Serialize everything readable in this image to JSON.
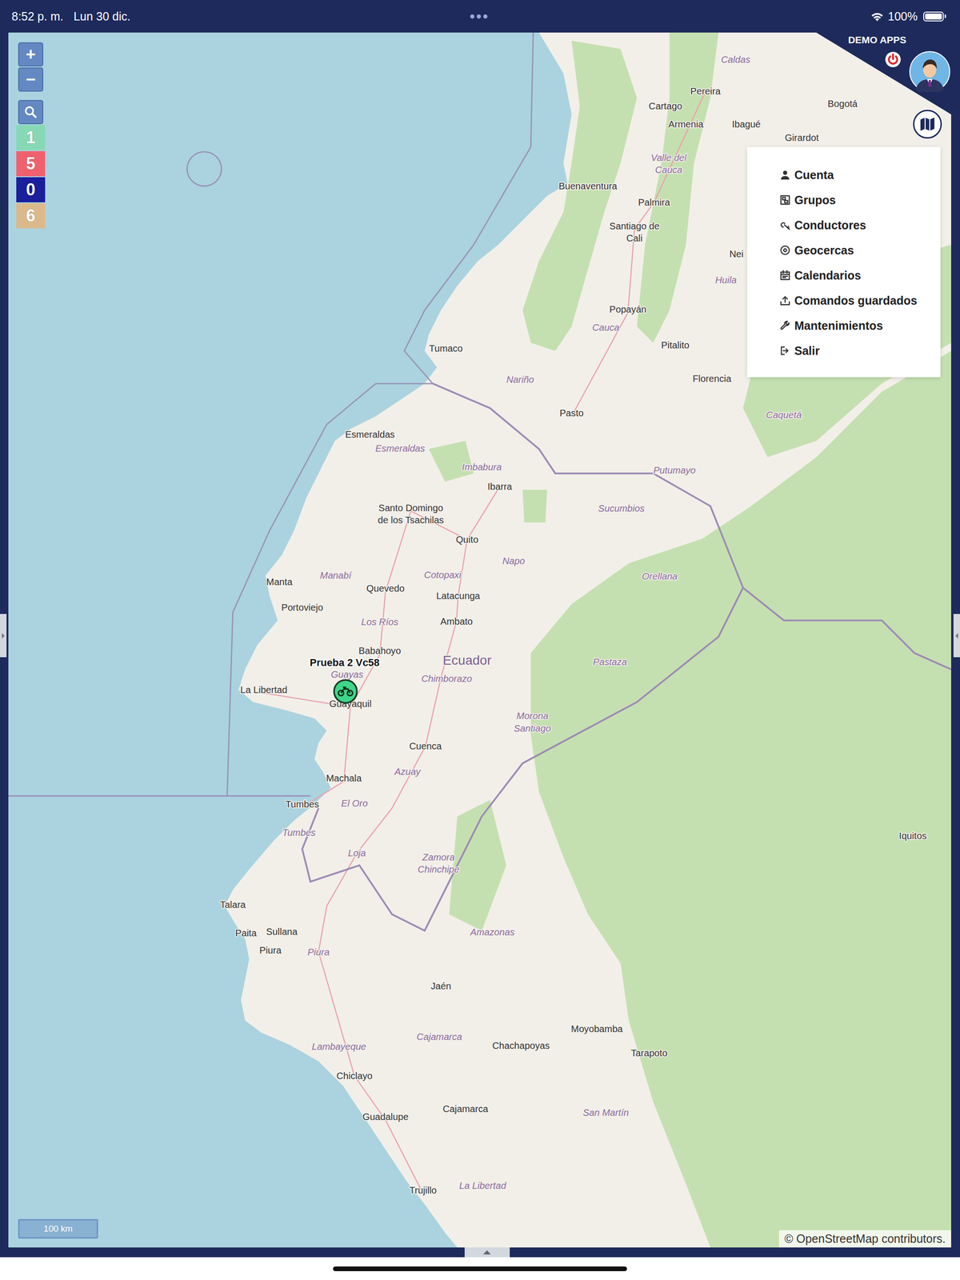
{
  "status_bar": {
    "time": "8:52 p. m.",
    "date": "Lun 30 dic.",
    "battery": "100%",
    "battery_level": 1
  },
  "map_controls": {
    "zoom_in": "+",
    "zoom_out": "−"
  },
  "counters": [
    {
      "value": "1",
      "color": "#86d9b4"
    },
    {
      "value": "5",
      "color": "#f0616f"
    },
    {
      "value": "0",
      "color": "#1a1f9c"
    },
    {
      "value": "6",
      "color": "#dcb98a"
    }
  ],
  "account": {
    "name": "DEMO APPS"
  },
  "menu": {
    "items": [
      {
        "label": "Cuenta"
      },
      {
        "label": "Grupos"
      },
      {
        "label": "Conductores"
      },
      {
        "label": "Geocercas"
      },
      {
        "label": "Calendarios"
      },
      {
        "label": "Comandos guardados"
      },
      {
        "label": "Mantenimientos"
      },
      {
        "label": "Salir"
      }
    ]
  },
  "vehicles": [
    {
      "name": "Prueba 2 Vc58",
      "color": "#3fd68a"
    }
  ],
  "map": {
    "labels": [
      {
        "lines": [
          "Caldas"
        ],
        "kind": "region"
      },
      {
        "lines": [
          "Pereira"
        ],
        "kind": "city"
      },
      {
        "lines": [
          "Cartago"
        ],
        "kind": "city"
      },
      {
        "lines": [
          "Armenia"
        ],
        "kind": "city"
      },
      {
        "lines": [
          "Ibagué"
        ],
        "kind": "city"
      },
      {
        "lines": [
          "Bogotá"
        ],
        "kind": "city"
      },
      {
        "lines": [
          "Girardot"
        ],
        "kind": "city"
      },
      {
        "lines": [
          "Valle del",
          "Cauca"
        ],
        "kind": "region"
      },
      {
        "lines": [
          "Buenaventura"
        ],
        "kind": "city"
      },
      {
        "lines": [
          "Palmira"
        ],
        "kind": "city"
      },
      {
        "lines": [
          "Santiago de",
          "Cali"
        ],
        "kind": "city"
      },
      {
        "lines": [
          "Nei"
        ],
        "kind": "city"
      },
      {
        "lines": [
          "Huila"
        ],
        "kind": "region"
      },
      {
        "lines": [
          "Popayán"
        ],
        "kind": "city"
      },
      {
        "lines": [
          "Cauca"
        ],
        "kind": "region"
      },
      {
        "lines": [
          "Pitalito"
        ],
        "kind": "city"
      },
      {
        "lines": [
          "Tumaco"
        ],
        "kind": "city"
      },
      {
        "lines": [
          "Nariño"
        ],
        "kind": "region"
      },
      {
        "lines": [
          "Pasto"
        ],
        "kind": "city"
      },
      {
        "lines": [
          "Florencia"
        ],
        "kind": "city"
      },
      {
        "lines": [
          "Caquetá"
        ],
        "kind": "region"
      },
      {
        "lines": [
          "Putumayo"
        ],
        "kind": "region"
      },
      {
        "lines": [
          "Esmeraldas"
        ],
        "kind": "city"
      },
      {
        "lines": [
          "Esmeraldas"
        ],
        "kind": "region"
      },
      {
        "lines": [
          "Imbabura"
        ],
        "kind": "region"
      },
      {
        "lines": [
          "Ibarra"
        ],
        "kind": "city"
      },
      {
        "lines": [
          "Sucumbios"
        ],
        "kind": "region"
      },
      {
        "lines": [
          "Santo Domingo",
          "de los Tsachilas"
        ],
        "kind": "city"
      },
      {
        "lines": [
          "Quito"
        ],
        "kind": "city"
      },
      {
        "lines": [
          "Napo"
        ],
        "kind": "region"
      },
      {
        "lines": [
          "Orellana"
        ],
        "kind": "region"
      },
      {
        "lines": [
          "Manta"
        ],
        "kind": "city"
      },
      {
        "lines": [
          "Manabí"
        ],
        "kind": "region"
      },
      {
        "lines": [
          "Portoviejo"
        ],
        "kind": "city"
      },
      {
        "lines": [
          "Quevedo"
        ],
        "kind": "city"
      },
      {
        "lines": [
          "Cotopaxi"
        ],
        "kind": "region"
      },
      {
        "lines": [
          "Latacunga"
        ],
        "kind": "city"
      },
      {
        "lines": [
          "Los Ríos"
        ],
        "kind": "region"
      },
      {
        "lines": [
          "Ambato"
        ],
        "kind": "city"
      },
      {
        "lines": [
          "Babahoyo"
        ],
        "kind": "city"
      },
      {
        "lines": [
          "Ecuador"
        ],
        "kind": "country"
      },
      {
        "lines": [
          "Chimborazo"
        ],
        "kind": "region"
      },
      {
        "lines": [
          "Pastaza"
        ],
        "kind": "region"
      },
      {
        "lines": [
          "La Libertad"
        ],
        "kind": "city"
      },
      {
        "lines": [
          "Guayas"
        ],
        "kind": "region"
      },
      {
        "lines": [
          "Guayaquil"
        ],
        "kind": "city"
      },
      {
        "lines": [
          "Cuenca"
        ],
        "kind": "city"
      },
      {
        "lines": [
          "Azuay"
        ],
        "kind": "region"
      },
      {
        "lines": [
          "Morona",
          "Santiago"
        ],
        "kind": "region"
      },
      {
        "lines": [
          "Machala"
        ],
        "kind": "city"
      },
      {
        "lines": [
          "El Oro"
        ],
        "kind": "region"
      },
      {
        "lines": [
          "Tumbes"
        ],
        "kind": "city"
      },
      {
        "lines": [
          "Tumbes"
        ],
        "kind": "region"
      },
      {
        "lines": [
          "Loja"
        ],
        "kind": "region"
      },
      {
        "lines": [
          "Zamora",
          "Chinchipe"
        ],
        "kind": "region"
      },
      {
        "lines": [
          "Iquitos"
        ],
        "kind": "city"
      },
      {
        "lines": [
          "Talara"
        ],
        "kind": "city"
      },
      {
        "lines": [
          "Paita"
        ],
        "kind": "city"
      },
      {
        "lines": [
          "Sullana"
        ],
        "kind": "city"
      },
      {
        "lines": [
          "Piura"
        ],
        "kind": "city"
      },
      {
        "lines": [
          "Piura"
        ],
        "kind": "region"
      },
      {
        "lines": [
          "Amazonas"
        ],
        "kind": "region"
      },
      {
        "lines": [
          "Jaén"
        ],
        "kind": "city"
      },
      {
        "lines": [
          "Moyobamba"
        ],
        "kind": "city"
      },
      {
        "lines": [
          "Tarapoto"
        ],
        "kind": "city"
      },
      {
        "lines": [
          "Chachapoyas"
        ],
        "kind": "city"
      },
      {
        "lines": [
          "Cajamarca"
        ],
        "kind": "region"
      },
      {
        "lines": [
          "Cajamarca"
        ],
        "kind": "city"
      },
      {
        "lines": [
          "San Martín"
        ],
        "kind": "region"
      },
      {
        "lines": [
          "Lambayeque"
        ],
        "kind": "region"
      },
      {
        "lines": [
          "Chiclayo"
        ],
        "kind": "city"
      },
      {
        "lines": [
          "Guadalupe"
        ],
        "kind": "city"
      },
      {
        "lines": [
          "Trujillo"
        ],
        "kind": "city"
      },
      {
        "lines": [
          "La Libertad"
        ],
        "kind": "region"
      }
    ],
    "scale": "100 km",
    "attribution": "© OpenStreetMap contributors."
  }
}
